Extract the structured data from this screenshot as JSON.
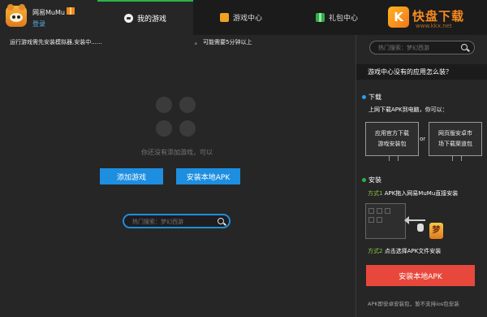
{
  "header": {
    "app_name": "网易MuMu",
    "login_label": "登录",
    "tabs": [
      {
        "label": "我的游戏",
        "active": true,
        "icon": "pet-icon"
      },
      {
        "label": "游戏中心",
        "active": false,
        "icon": "game-center-icon"
      },
      {
        "label": "礼包中心",
        "active": false,
        "icon": "gift-icon"
      }
    ],
    "brand": {
      "mark": "K",
      "name": "快盘下载",
      "url": "www.kkx.net"
    }
  },
  "main": {
    "status_left": "运行游戏需先安装模拟器,安装中......",
    "status_mid": "。",
    "status_right": "可能需要5分钟以上",
    "empty_text": "你还没有添加游戏，可以",
    "add_game_button": "添加游戏",
    "install_apk_button": "安装本地APK",
    "search_placeholder": "热门搜索：梦幻西游"
  },
  "side": {
    "search_placeholder": "热门搜索：梦幻西游",
    "title": "游戏中心没有的应用怎么装？",
    "download": {
      "title": "下载",
      "desc": "上网下载APK到电脑，你可以：",
      "option1_line1": "应用官方下载",
      "option1_line2": "游戏安装包",
      "or": "or",
      "option2_line1": "网页版安卓市",
      "option2_line2": "场下载渠道包"
    },
    "install": {
      "title": "安装",
      "method1_tag": "方式1",
      "method1_text": "APK拖入网易MuMu直接安装",
      "method2_tag": "方式2",
      "method2_text": "点击选择APK文件安装",
      "apk_icon_text": "梦"
    },
    "install_button": "安装本地APK",
    "footnote": "APK即安卓安装包，暂不支持ios包安装"
  },
  "colors": {
    "background": "#262626",
    "header_bg": "#1b1b1b",
    "active_tab_accent": "#2bb34a",
    "primary_blue": "#1d8ee0",
    "install_red": "#e8483c",
    "method_green": "#8ec63f",
    "brand_orange": "#f68a1e"
  }
}
